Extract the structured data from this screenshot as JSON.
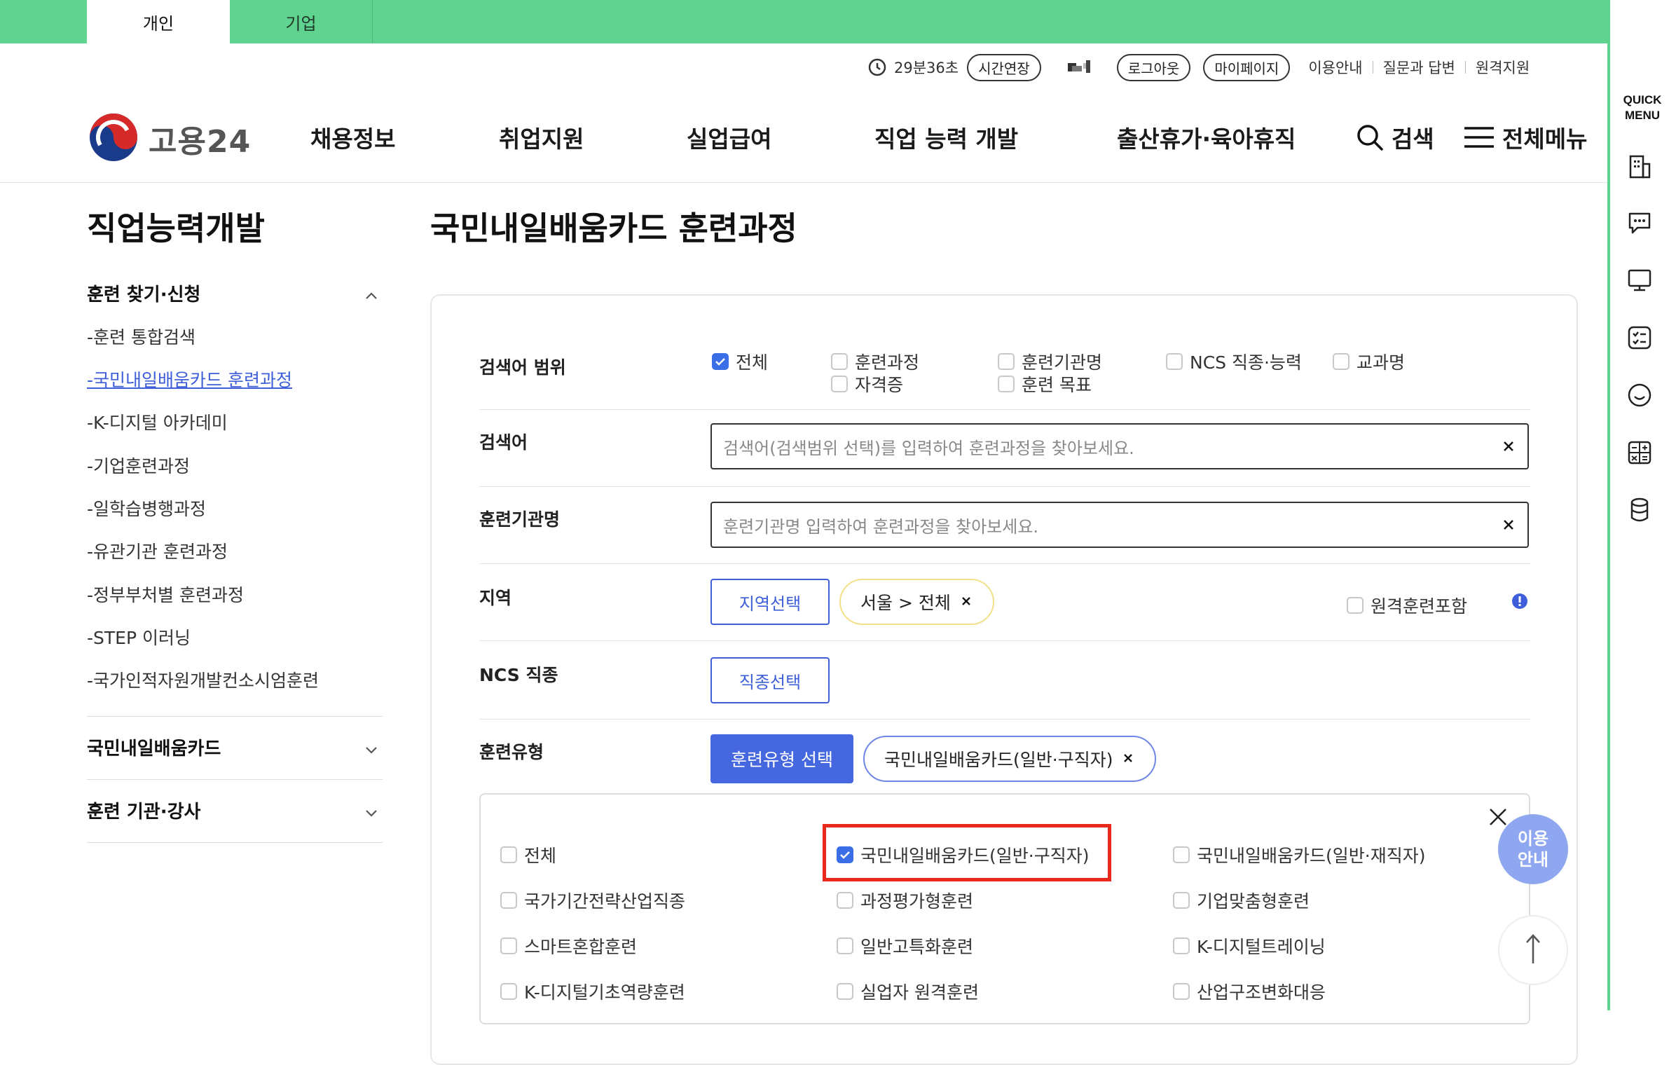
{
  "tabs": [
    {
      "label": "개인",
      "active": true
    },
    {
      "label": "기업",
      "active": false
    }
  ],
  "utility": {
    "timer": "29분36초",
    "extend_label": "시간연장",
    "logout_label": "로그아웃",
    "mypage_label": "마이페이지",
    "links": [
      "이용안내",
      "질문과 답변",
      "원격지원"
    ]
  },
  "header": {
    "logo_text": "고용24",
    "nav": [
      "채용정보",
      "취업지원",
      "실업급여",
      "직업 능력 개발",
      "출산휴가·육아휴직"
    ],
    "search_label": "검색",
    "menu_label": "전체메뉴"
  },
  "quick_menu": {
    "title_line1": "QUICK",
    "title_line2": "MENU",
    "icons": [
      "building-icon",
      "chat-icon",
      "monitor-icon",
      "checklist-icon",
      "smile-icon",
      "calculator-icon",
      "database-icon"
    ]
  },
  "sidebar": {
    "title": "직업능력개발",
    "group1": "훈련 찾기·신청",
    "items": [
      "-훈련 통합검색",
      "-국민내일배움카드 훈련과정",
      "-K-디지털 아카데미",
      "-기업훈련과정",
      "-일학습병행과정",
      "-유관기관 훈련과정",
      "-정부부처별 훈련과정",
      "-STEP 이러닝",
      "-국가인적자원개발컨소시엄훈련"
    ],
    "active_index": 1,
    "group2": "국민내일배움카드",
    "group3": "훈련 기관·강사"
  },
  "main": {
    "title": "국민내일배움카드 훈련과정",
    "scope_label": "검색어 범위",
    "scope_options": [
      {
        "label": "전체",
        "checked": true
      },
      {
        "label": "훈련과정",
        "checked": false
      },
      {
        "label": "자격증",
        "checked": false
      },
      {
        "label": "훈련기관명",
        "checked": false
      },
      {
        "label": "훈련 목표",
        "checked": false
      },
      {
        "label": "NCS 직종·능력",
        "checked": false
      },
      {
        "label": "교과명",
        "checked": false
      }
    ],
    "keyword_label": "검색어",
    "keyword_placeholder": "검색어(검색범위 선택)를 입력하여 훈련과정을 찾아보세요.",
    "institution_label": "훈련기관명",
    "institution_placeholder": "훈련기관명 입력하여 훈련과정을 찾아보세요.",
    "region_label": "지역",
    "region_button": "지역선택",
    "region_chip": "서울 > 전체",
    "remote_label": "원격훈련포함",
    "ncs_label": "NCS 직종",
    "ncs_button": "직종선택",
    "type_label": "훈련유형",
    "type_button": "훈련유형 선택",
    "type_chip": "국민내일배움카드(일반·구직자)",
    "type_options": [
      {
        "label": "전체",
        "checked": false
      },
      {
        "label": "국민내일배움카드(일반·구직자)",
        "checked": true
      },
      {
        "label": "국민내일배움카드(일반·재직자)",
        "checked": false
      },
      {
        "label": "국가기간전략산업직종",
        "checked": false
      },
      {
        "label": "과정평가형훈련",
        "checked": false
      },
      {
        "label": "기업맞춤형훈련",
        "checked": false
      },
      {
        "label": "스마트혼합훈련",
        "checked": false
      },
      {
        "label": "일반고특화훈련",
        "checked": false
      },
      {
        "label": "K-디지털트레이닝",
        "checked": false
      },
      {
        "label": "K-디지털기초역량훈련",
        "checked": false
      },
      {
        "label": "실업자 원격훈련",
        "checked": false
      },
      {
        "label": "산업구조변화대응",
        "checked": false
      }
    ]
  },
  "floating": {
    "help_line1": "이용",
    "help_line2": "안내"
  },
  "colors": {
    "brand_green": "#5fd38f",
    "accent_blue": "#3e5fd9",
    "highlight_red": "#e8291c"
  }
}
